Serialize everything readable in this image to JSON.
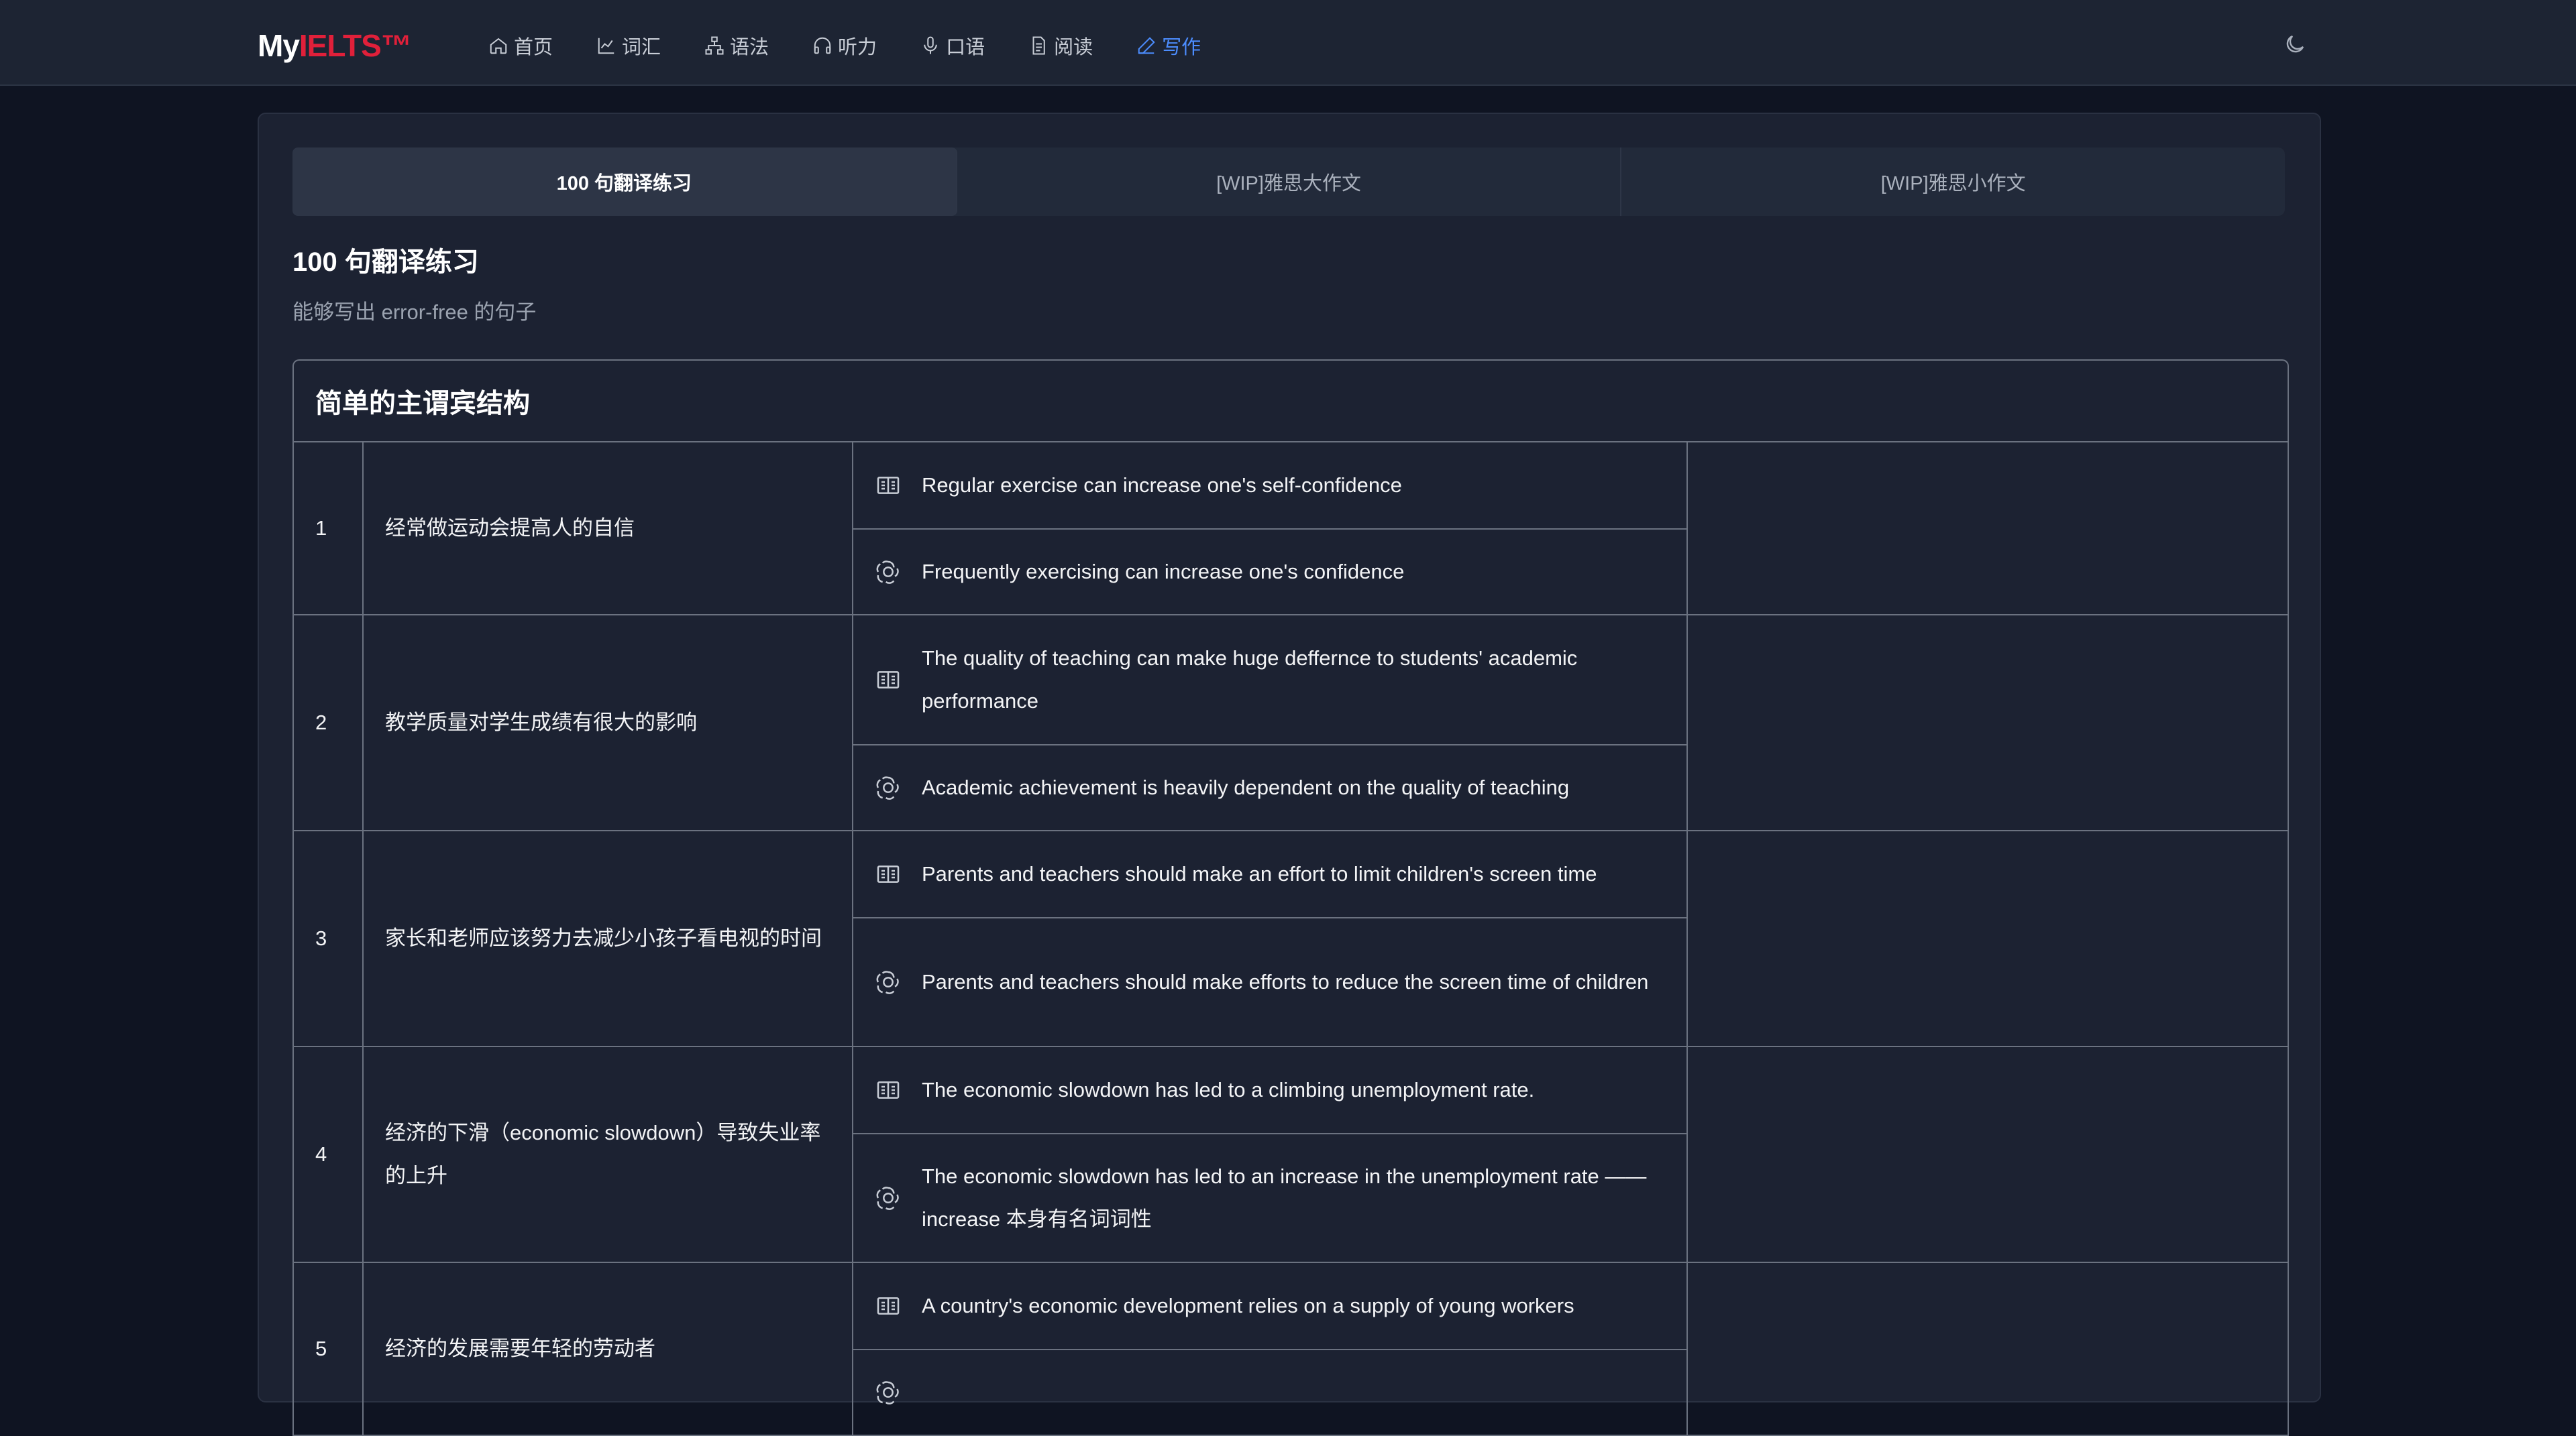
{
  "brand": {
    "my": "My",
    "ielts": "IELTS™"
  },
  "nav": {
    "items": [
      {
        "label": "首页",
        "icon": "home-icon"
      },
      {
        "label": "词汇",
        "icon": "chart-icon"
      },
      {
        "label": "语法",
        "icon": "sitemap-icon"
      },
      {
        "label": "听力",
        "icon": "headphones-icon"
      },
      {
        "label": "口语",
        "icon": "microphone-icon"
      },
      {
        "label": "阅读",
        "icon": "document-icon"
      },
      {
        "label": "写作",
        "icon": "pen-icon",
        "active": true
      }
    ],
    "theme_toggle_icon": "moon-icon"
  },
  "tabs": [
    "100 句翻译练习",
    "[WIP]雅思大作文",
    "[WIP]雅思小作文"
  ],
  "section": {
    "title": "100 句翻译练习",
    "subtitle": "能够写出 error-free 的句子"
  },
  "table": {
    "heading": "简单的主谓宾结构",
    "rows": [
      {
        "num": "1",
        "cn": "经常做运动会提高人的自信",
        "mine": "Regular exercise can increase one's self-confidence",
        "ai": "Frequently exercising can increase one's confidence"
      },
      {
        "num": "2",
        "cn": "教学质量对学生成绩有很大的影响",
        "mine": "The quality of teaching can make huge deffernce to students' academic performance",
        "ai": "Academic achievement is heavily dependent on the quality of teaching"
      },
      {
        "num": "3",
        "cn": "家长和老师应该努力去减少小孩子看电视的时间",
        "mine": "Parents and teachers should make an effort to limit children's screen time",
        "ai": "Parents and teachers should make efforts to reduce the screen time of children"
      },
      {
        "num": "4",
        "cn": "经济的下滑（economic slowdown）导致失业率的上升",
        "mine": "The economic slowdown has led to a climbing unemployment rate.",
        "ai": "The economic slowdown has led to an increase in the unemployment rate —— increase 本身有名词词性"
      },
      {
        "num": "5",
        "cn": "经济的发展需要年轻的劳动者",
        "mine": "A country's economic development relies on a supply of young workers",
        "ai": ""
      }
    ]
  },
  "colors": {
    "accent": "#4c8dff",
    "brand_red": "#e0203a",
    "background": "#0f1422"
  }
}
